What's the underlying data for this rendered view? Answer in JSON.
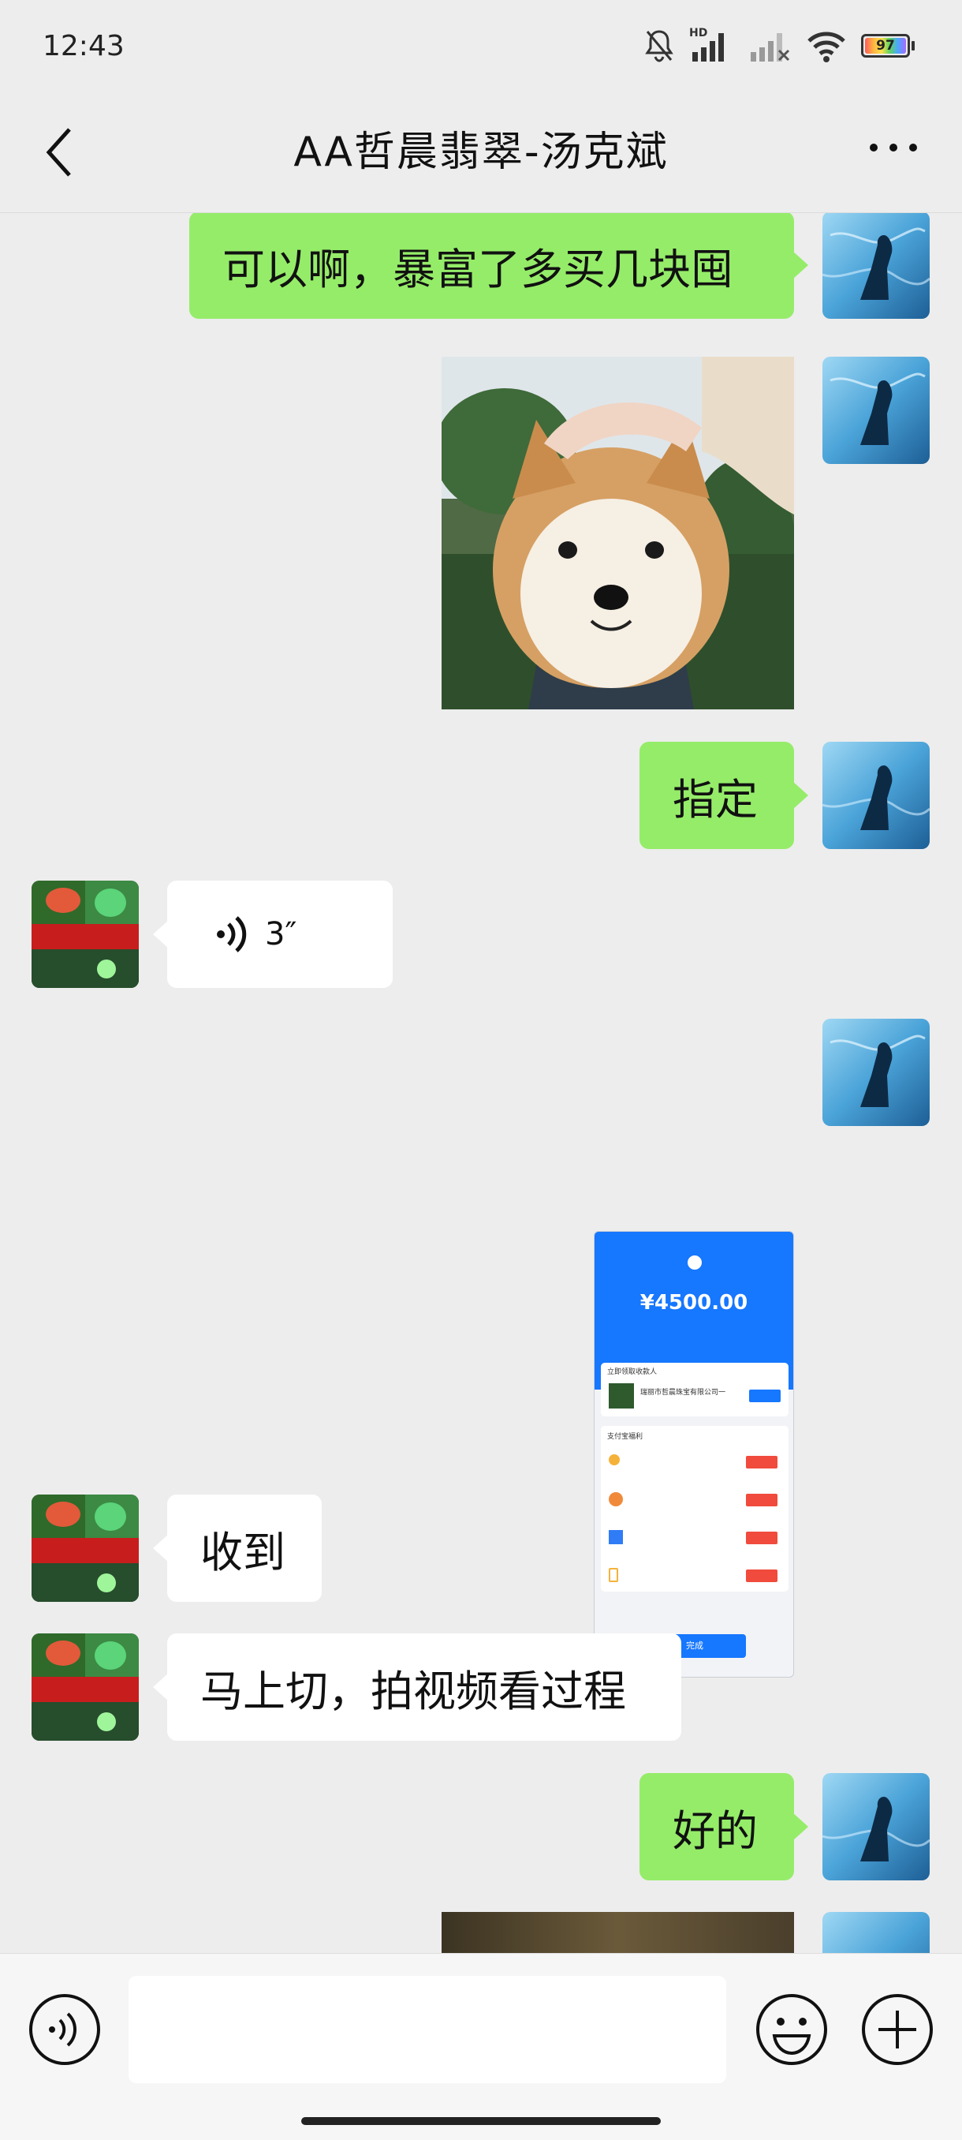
{
  "status_bar": {
    "time": "12:43",
    "hd_label": "HD",
    "battery": "97"
  },
  "header": {
    "title": "AA哲晨翡翠-汤克斌"
  },
  "messages": [
    {
      "side": "me",
      "type": "text",
      "text": "可以啊，暴富了多买几块囤"
    },
    {
      "side": "me",
      "type": "image",
      "content": "shiba-dog-photo"
    },
    {
      "side": "me",
      "type": "text",
      "text": "指定"
    },
    {
      "side": "other",
      "type": "voice",
      "duration": "3″"
    },
    {
      "side": "me",
      "type": "image",
      "content": "payment-receipt-screenshot"
    },
    {
      "side": "other",
      "type": "text",
      "text": "收到"
    },
    {
      "side": "other",
      "type": "text",
      "text": "马上切，拍视频看过程"
    },
    {
      "side": "me",
      "type": "text",
      "text": "好的"
    },
    {
      "side": "me",
      "type": "image",
      "content": "partial-photo"
    }
  ],
  "avatars": {
    "other": {
      "lines": [
        "翡翠原石",
        "璞玉天成",
        "只做优质高货货源"
      ],
      "corner": "翡翠\n直卖"
    }
  },
  "receipt": {
    "amount": "¥4500.00",
    "payee": "瑞丽市哲晨珠宝有限公司一",
    "section": "立即领取收款人",
    "benefits_title": "支付宝福利",
    "done_label": "完成"
  },
  "input_bar": {
    "voice_icon": "voice-icon",
    "emoji_icon": "emoji-icon",
    "plus_icon": "plus-icon"
  },
  "colors": {
    "my_bubble": "#95ec69",
    "other_bubble": "#ffffff",
    "background": "#ededed",
    "alipay_blue": "#1677ff"
  }
}
